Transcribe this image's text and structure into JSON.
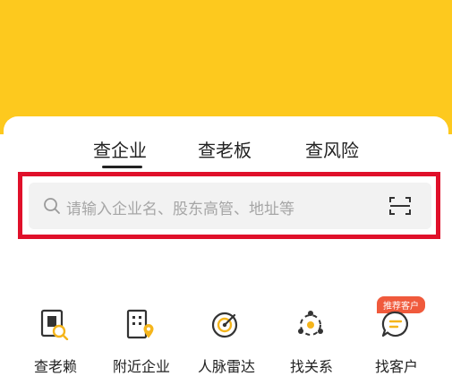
{
  "tabs": [
    {
      "label": "查企业",
      "active": true
    },
    {
      "label": "查老板",
      "active": false
    },
    {
      "label": "查风险",
      "active": false
    }
  ],
  "search": {
    "placeholder": "请输入企业名、股东高管、地址等",
    "search_icon": "search-icon",
    "scan_icon": "scan-icon"
  },
  "shortcuts": [
    {
      "label": "查老赖",
      "icon": "debtor-search-icon"
    },
    {
      "label": "附近企业",
      "icon": "nearby-building-icon"
    },
    {
      "label": "人脉雷达",
      "icon": "radar-icon"
    },
    {
      "label": "找关系",
      "icon": "network-icon"
    },
    {
      "label": "找客户",
      "icon": "chat-customer-icon",
      "badge": "推荐客户"
    }
  ],
  "colors": {
    "banner": "#fdc91e",
    "highlight_frame": "#e0102a",
    "icon_accent": "#f5b51b",
    "badge": "#f05a3c"
  }
}
